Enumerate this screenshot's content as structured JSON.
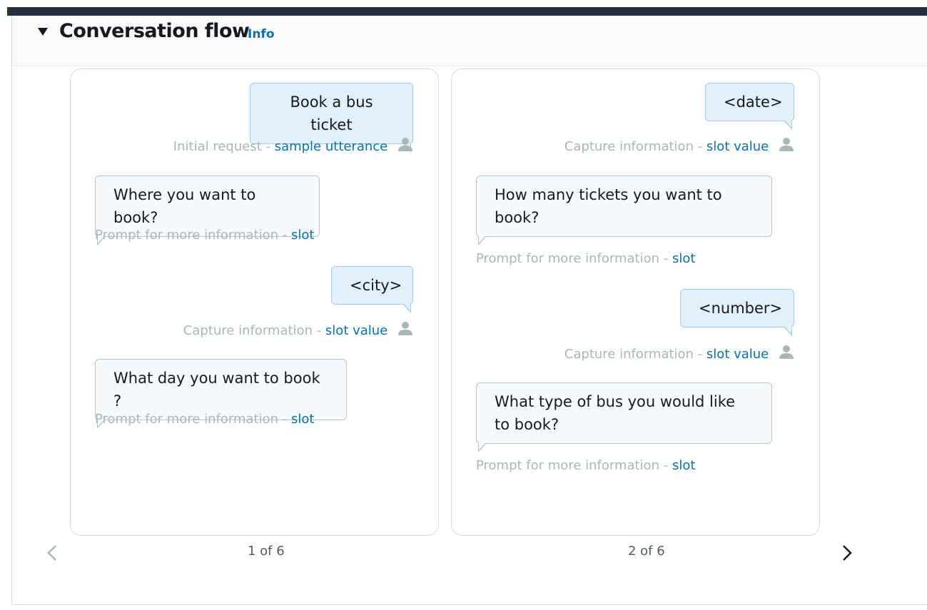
{
  "header": {
    "title": "Conversation flow",
    "info_label": "Info"
  },
  "cards": [
    {
      "page_label": "1 of 6",
      "items": [
        {
          "kind": "user",
          "text": "Book a bus ticket",
          "caption_prefix": "Initial request - ",
          "caption_link": "sample utterance"
        },
        {
          "kind": "bot",
          "text": "Where you want to book?",
          "caption_prefix": "Prompt for more information - ",
          "caption_link": "slot"
        },
        {
          "kind": "user",
          "text": "<city>",
          "caption_prefix": "Capture information - ",
          "caption_link": "slot value"
        },
        {
          "kind": "bot",
          "text": "What day you want to book ?",
          "caption_prefix": "Prompt for more information - ",
          "caption_link": "slot"
        }
      ]
    },
    {
      "page_label": "2 of 6",
      "items": [
        {
          "kind": "user",
          "text": "<date>",
          "caption_prefix": "Capture information - ",
          "caption_link": "slot value"
        },
        {
          "kind": "bot",
          "text": "How many tickets you want to book?",
          "caption_prefix": "Prompt for more information - ",
          "caption_link": "slot"
        },
        {
          "kind": "user",
          "text": "<number>",
          "caption_prefix": "Capture information - ",
          "caption_link": "slot value"
        },
        {
          "kind": "bot",
          "text": "What type of bus you would like to book?",
          "caption_prefix": "Prompt for more information - ",
          "caption_link": "slot"
        }
      ]
    }
  ],
  "icons": {
    "collapse": "caret-down-icon",
    "user": "user-icon",
    "prev": "chevron-left-icon",
    "next": "chevron-right-icon"
  },
  "colors": {
    "link": "#0073bb",
    "user_bubble": "#e1f0fc",
    "bot_bubble": "#f7fafd",
    "caption": "#aab7b8"
  }
}
